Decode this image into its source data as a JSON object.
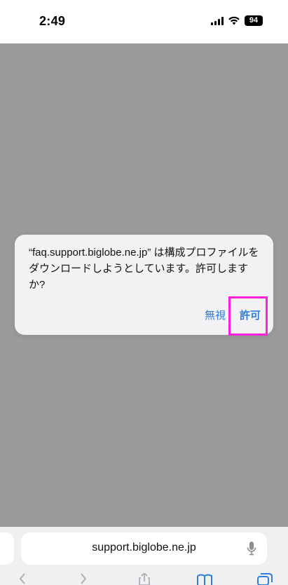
{
  "status_bar": {
    "time": "2:49",
    "battery": "94"
  },
  "alert": {
    "message": "“faq.support.biglobe.ne.jp” は構成プロファイルをダウンロードしようとしています。許可しますか?",
    "deny_label": "無視",
    "allow_label": "許可"
  },
  "toolbar": {
    "url": "support.biglobe.ne.jp"
  },
  "colors": {
    "accent": "#2f7ed8",
    "highlight": "#ff1fe0",
    "dim": "#9b9b9b"
  },
  "icons": [
    "signal-icon",
    "wifi-icon",
    "microphone-icon",
    "back-icon",
    "forward-icon",
    "share-icon",
    "bookmarks-icon",
    "tabs-icon"
  ]
}
